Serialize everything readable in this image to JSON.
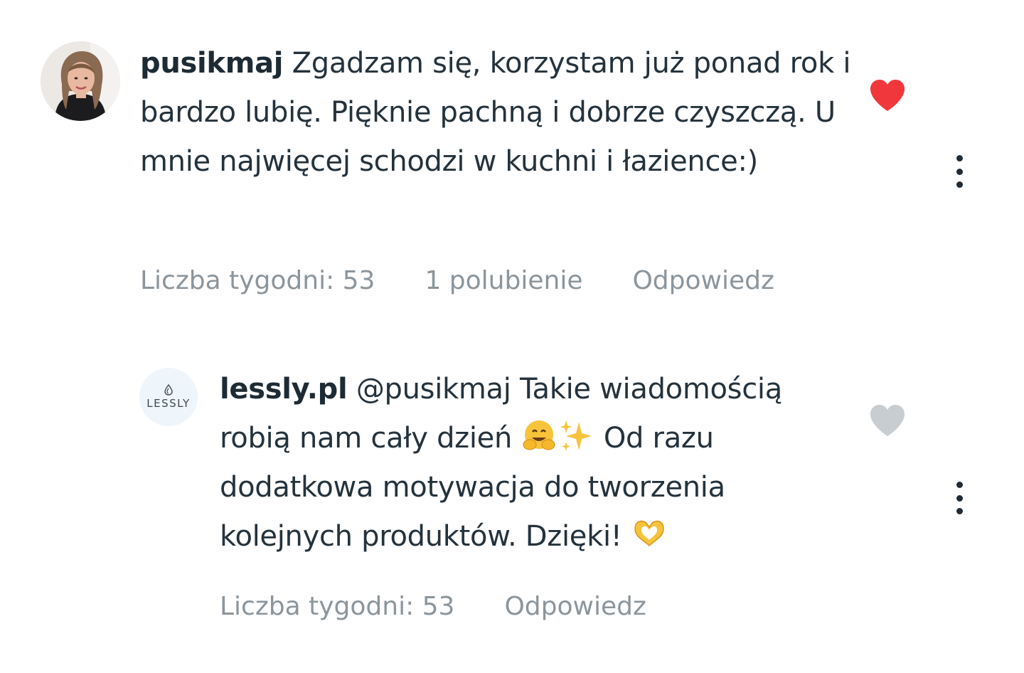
{
  "comments": [
    {
      "username": "pusikmaj",
      "text": " Zgadzam się, korzystam już ponad rok i bardzo lubię. Pięknie pachną i dobrze czyszczą. U mnie najwięcej schodzi w kuchni i łazience:)",
      "weeks": "Liczba tygodni: 53",
      "likes": "1 polubienie",
      "reply": "Odpowiedz",
      "liked": true,
      "avatar": "user-photo"
    },
    {
      "username": "lessly.pl",
      "text_part1": " @pusikmaj Takie wiadomością robią nam cały dzień ",
      "emoji1": "hugging-face",
      "emoji2": "sparkles",
      "text_part2": " Od razu dodatkowa motywacja do tworzenia kolejnych produktów. Dzięki! ",
      "emoji3": "heart-hands",
      "weeks": "Liczba tygodni: 53",
      "reply": "Odpowiedz",
      "liked": false,
      "avatar_text": "LESSLY"
    }
  ],
  "colors": {
    "heart_active": "#f0373c",
    "heart_inactive": "#c8cdd1",
    "meta_text": "#8b959c",
    "body_text": "#24323c"
  },
  "icons": {
    "like": "heart-icon",
    "more": "more-vertical-icon"
  }
}
